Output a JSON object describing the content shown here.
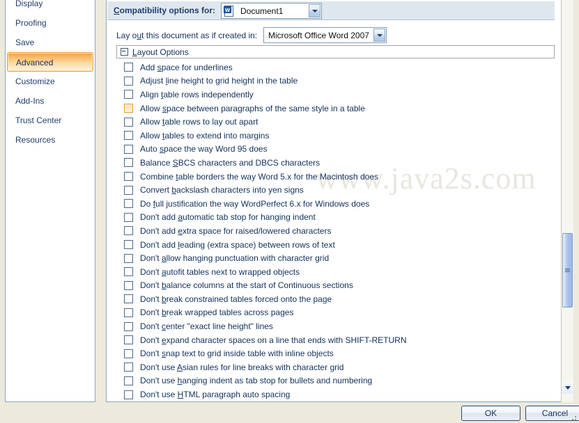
{
  "sidebar": {
    "items": [
      {
        "label": "Display",
        "selected": false
      },
      {
        "label": "Proofing",
        "selected": false
      },
      {
        "label": "Save",
        "selected": false
      },
      {
        "label": "Advanced",
        "selected": true
      },
      {
        "label": "Customize",
        "selected": false
      },
      {
        "label": "Add-Ins",
        "selected": false
      },
      {
        "label": "Trust Center",
        "selected": false
      },
      {
        "label": "Resources",
        "selected": false
      }
    ]
  },
  "compatibility": {
    "label": "Compatibility options for:",
    "document_icon": "word-document-icon",
    "document_value": "Document1",
    "dropdown_icon": "chevron-down-icon"
  },
  "layout_as": {
    "label": "Lay out this document as if created in:",
    "label_accel": "u",
    "value": "Microsoft Office Word 2007",
    "dropdown_icon": "chevron-down-icon"
  },
  "group": {
    "title": "Layout Options",
    "toggle_icon": "collapse-minus-icon",
    "expanded": true
  },
  "options": [
    {
      "pre": "Add ",
      "accel": "s",
      "post": "pace for underlines",
      "checked": false,
      "highlighted": false
    },
    {
      "pre": "Adjust ",
      "accel": "l",
      "post": "ine height to grid height in the table",
      "checked": false,
      "highlighted": false
    },
    {
      "pre": "Align ",
      "accel": "t",
      "post": "able rows independently",
      "checked": false,
      "highlighted": false
    },
    {
      "pre": "Allow ",
      "accel": "s",
      "post": "pace between paragraphs of the same style in a table",
      "checked": false,
      "highlighted": true
    },
    {
      "pre": "Allow ",
      "accel": "t",
      "post": "able rows to lay out apart",
      "checked": false,
      "highlighted": false
    },
    {
      "pre": "Allow ",
      "accel": "t",
      "post": "ables to extend into margins",
      "checked": false,
      "highlighted": false
    },
    {
      "pre": "Auto ",
      "accel": "s",
      "post": "pace the way Word 95 does",
      "checked": false,
      "highlighted": false
    },
    {
      "pre": "Balance ",
      "accel": "S",
      "post": "BCS characters and DBCS characters",
      "checked": false,
      "highlighted": false
    },
    {
      "pre": "Combine ",
      "accel": "t",
      "post": "able borders the way Word 5.x for the Macintosh does",
      "checked": false,
      "highlighted": false
    },
    {
      "pre": "Convert ",
      "accel": "b",
      "post": "ackslash characters into yen signs",
      "checked": false,
      "highlighted": false
    },
    {
      "pre": "Do ",
      "accel": "f",
      "post": "ull justification the way WordPerfect 6.x for Windows does",
      "checked": false,
      "highlighted": false
    },
    {
      "pre": "Don't add ",
      "accel": "a",
      "post": "utomatic tab stop for hanging indent",
      "checked": false,
      "highlighted": false
    },
    {
      "pre": "Don't add ",
      "accel": "e",
      "post": "xtra space for raised/lowered characters",
      "checked": false,
      "highlighted": false
    },
    {
      "pre": "Don't add ",
      "accel": "l",
      "post": "eading (extra space) between rows of text",
      "checked": false,
      "highlighted": false
    },
    {
      "pre": "Don't ",
      "accel": "a",
      "post": "llow hanging punctuation with character grid",
      "checked": false,
      "highlighted": false
    },
    {
      "pre": "Don't ",
      "accel": "a",
      "post": "utofit tables next to wrapped objects",
      "checked": false,
      "highlighted": false
    },
    {
      "pre": "Don't ",
      "accel": "b",
      "post": "alance columns at the start of Continuous sections",
      "checked": false,
      "highlighted": false
    },
    {
      "pre": "Don't ",
      "accel": "b",
      "post": "reak constrained tables forced onto the page",
      "checked": false,
      "highlighted": false
    },
    {
      "pre": "Don't ",
      "accel": "b",
      "post": "reak wrapped tables across pages",
      "checked": false,
      "highlighted": false
    },
    {
      "pre": "Don't ",
      "accel": "c",
      "post": "enter \"exact line height\" lines",
      "checked": false,
      "highlighted": false
    },
    {
      "pre": "Don't ",
      "accel": "e",
      "post": "xpand character spaces on a line that ends with SHIFT-RETURN",
      "checked": false,
      "highlighted": false
    },
    {
      "pre": "Don't ",
      "accel": "s",
      "post": "nap text to grid inside table with inline objects",
      "checked": false,
      "highlighted": false
    },
    {
      "pre": "Don't use ",
      "accel": "A",
      "post": "sian rules for line breaks with character grid",
      "checked": false,
      "highlighted": false
    },
    {
      "pre": "Don't use ",
      "accel": "h",
      "post": "anging indent as tab stop for bullets and numbering",
      "checked": false,
      "highlighted": false
    },
    {
      "pre": "Don't use ",
      "accel": "H",
      "post": "TML paragraph auto spacing",
      "checked": false,
      "highlighted": false
    },
    {
      "pre": "",
      "accel": "",
      "post": "",
      "checked": false,
      "highlighted": false
    }
  ],
  "scrollbar": {
    "down_arrow_icon": "chevron-down-icon",
    "thumb_grip_icon": "grip-lines-icon"
  },
  "buttons": {
    "ok": "OK",
    "cancel": "Cancel"
  },
  "watermark": "www.java2s.com",
  "colors": {
    "accent_orange": "#e8973a",
    "header_band": "#dfe7ee",
    "dialog_background": "#ece9dd",
    "text_blue": "#12305d"
  }
}
